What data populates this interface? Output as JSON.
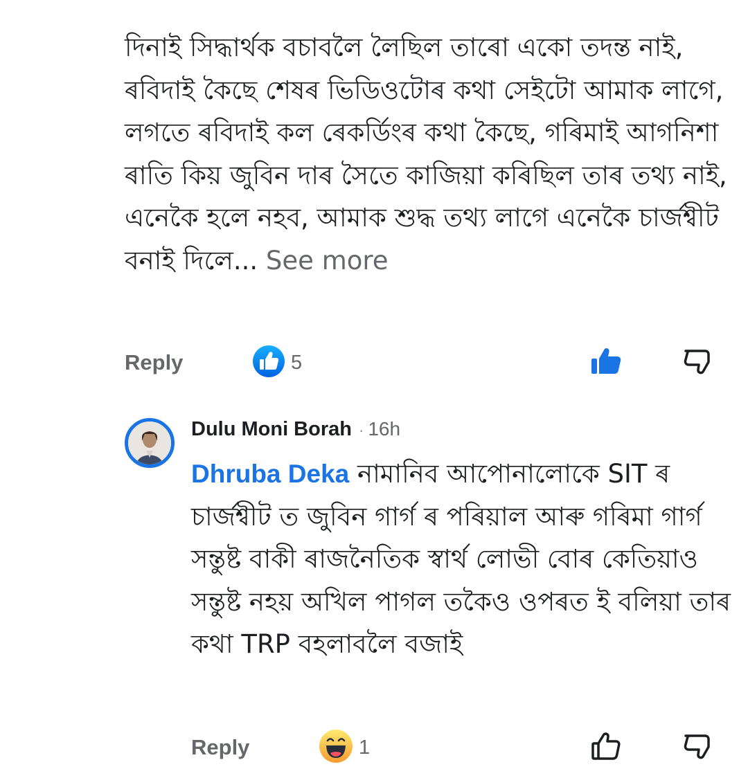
{
  "comment1": {
    "text": "দিনাই সিদ্ধাৰ্থক বচাবলৈ লৈছিল তাৰো একো তদন্ত নাই, ৰবিদাই কৈছে শেষৰ ভিডিওটোৰ কথা সেইটো আমাক লাগে, লগতে ৰবিদাই কল ৰেকৰ্ডিংৰ কথা কৈছে, গৰিমাই আগনিশা ৰাতি কিয় জুবিন দাৰ সৈতে কাজিয়া কৰিছিল তাৰ তথ্য নাই, এনেকৈ হলে নহব, আমাক শুদ্ধ তথ্য লাগে এনেকৈ চাৰ্জশ্বীট বনাই দিলে...",
    "see_more": " See more",
    "reply_label": "Reply",
    "reaction_count": "5",
    "reaction_icon": "like-reaction-icon",
    "liked": true
  },
  "comment2": {
    "author": "Dulu Moni Borah",
    "separator": "·",
    "time": "16h",
    "mention": "Dhruba Deka",
    "text": " নামানিব আপোনালোকে SIT ৰ চাৰ্জশ্বীট ত জুবিন গাৰ্গ ৰ পৰিয়াল আৰু গৰিমা গাৰ্গ সন্তুষ্ট বাকী ৰাজনৈতিক স্বাৰ্থ লোভী বোৰ কেতিয়াও সন্তুষ্ট নহয় অখিল পাগল তকৈও ওপৰত  ই বলিয়া তাৰ কথা  TRP বহলাবলৈ বজাই",
    "reply_label": "Reply",
    "reaction_count": "1",
    "reaction_icon": "haha-reaction-icon",
    "liked": false
  },
  "colors": {
    "accent": "#1b74e4",
    "secondary_text": "#65676b",
    "primary_text": "#1c1e21"
  }
}
